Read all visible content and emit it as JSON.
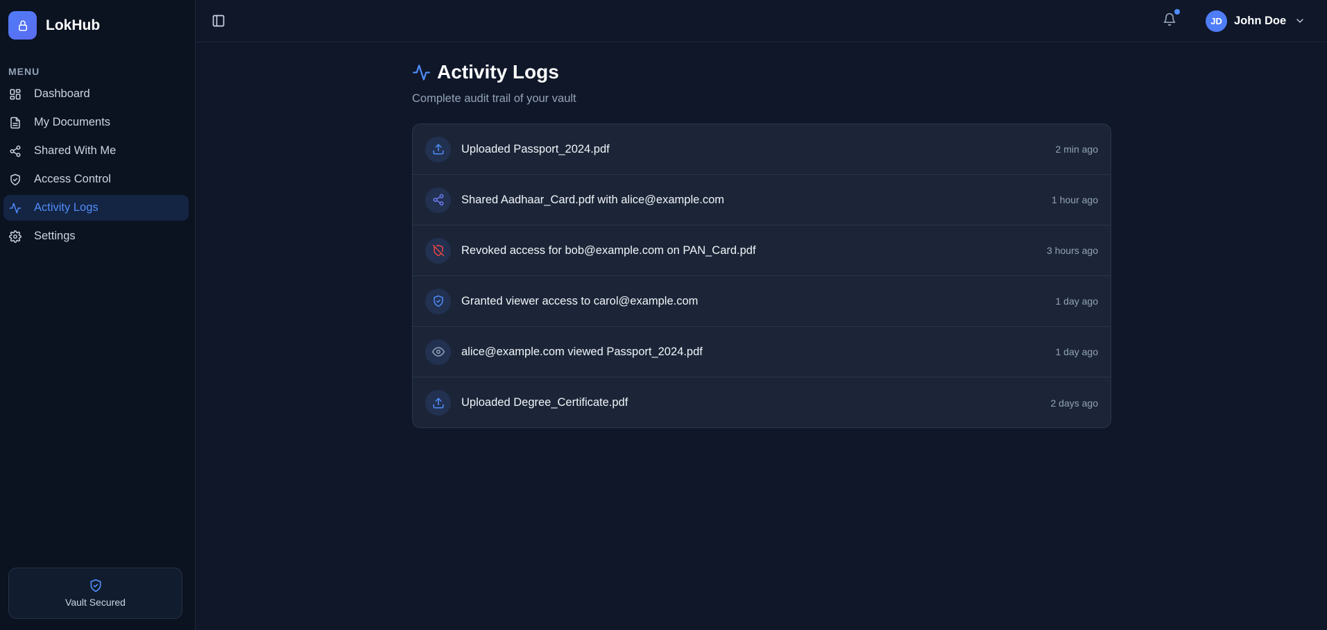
{
  "brand": {
    "name": "LokHub",
    "icon": "lock-icon"
  },
  "sidebar": {
    "menu_label": "MENU",
    "items": [
      {
        "label": "Dashboard",
        "icon": "grid-icon",
        "active": false
      },
      {
        "label": "My Documents",
        "icon": "file-icon",
        "active": false
      },
      {
        "label": "Shared With Me",
        "icon": "share-icon",
        "active": false
      },
      {
        "label": "Access Control",
        "icon": "shield-check-icon",
        "active": false
      },
      {
        "label": "Activity Logs",
        "icon": "activity-icon",
        "active": true
      },
      {
        "label": "Settings",
        "icon": "gear-icon",
        "active": false
      }
    ],
    "status": {
      "label": "Vault Secured",
      "icon": "shield-check-icon"
    }
  },
  "header": {
    "user": {
      "initials": "JD",
      "name": "John Doe"
    },
    "notification_dot": true
  },
  "main": {
    "title": "Activity Logs",
    "subtitle": "Complete audit trail of your vault",
    "logs": [
      {
        "text": "Uploaded Passport_2024.pdf",
        "time": "2 min ago",
        "icon": "upload-icon",
        "color": "#4f8df9"
      },
      {
        "text": "Shared Aadhaar_Card.pdf with alice@example.com",
        "time": "1 hour ago",
        "icon": "share-icon",
        "color": "#6c7bf5"
      },
      {
        "text": "Revoked access for bob@example.com on PAN_Card.pdf",
        "time": "3 hours ago",
        "icon": "shield-off-icon",
        "color": "#ef4444"
      },
      {
        "text": "Granted viewer access to carol@example.com",
        "time": "1 day ago",
        "icon": "shield-check-icon",
        "color": "#4f8df9"
      },
      {
        "text": "alice@example.com viewed Passport_2024.pdf",
        "time": "1 day ago",
        "icon": "eye-icon",
        "color": "#94a3b8"
      },
      {
        "text": "Uploaded Degree_Certificate.pdf",
        "time": "2 days ago",
        "icon": "upload-icon",
        "color": "#4f8df9"
      }
    ]
  },
  "colors": {
    "accent": "#4f8df9",
    "background": "#0f1729",
    "sidebar": "#0b1220",
    "card": "#1b2537"
  }
}
